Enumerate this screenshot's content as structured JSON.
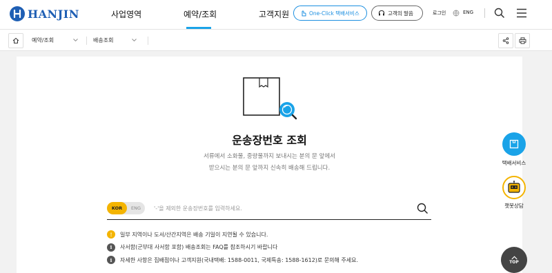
{
  "header": {
    "logo_text": "HANJIN",
    "nav": [
      "사업영역",
      "예약/조회",
      "고객지원"
    ],
    "one_click_label": "One-Click 택배서비스",
    "voice_label": "고객의 말씀",
    "login_label": "로그인",
    "lang_label": "ENG",
    "icons": [
      "search-icon",
      "hamburger-menu-icon"
    ]
  },
  "breadcrumb": {
    "items": [
      "예약/조회",
      "배송조회"
    ]
  },
  "main": {
    "title": "운송장번호 조회",
    "desc_line1": "서류에서 소화물, 중량물까지 보내시는 분의 문 앞에서",
    "desc_line2": "받으시는 분의 문 앞까지 신속히 배송해 드립니다.",
    "lang_kor": "KOR",
    "lang_eng": "ENG",
    "search_placeholder": "'-'을 제외한 운송장번호를 입력하세요."
  },
  "notices": [
    "일부 지역이나 도서/산간지역은 배송 기일이 지연될 수 있습니다.",
    "사서함(군부대 사서함 포함) 배송조회는 FAQ를 참조하시기 바랍니다",
    "자세한 사항은 집배점이나 고객지원(국내택배: 1588-0011, 국제특송: 1588-1612)로 문의해 주세요."
  ],
  "floating": {
    "parcel_label": "택배서비스",
    "chatbot_label": "챗봇상담",
    "top_label": "TOP"
  },
  "colors": {
    "brand": "#1f5fb4",
    "accent": "#1aa3e8",
    "highlight": "#f4b400"
  }
}
